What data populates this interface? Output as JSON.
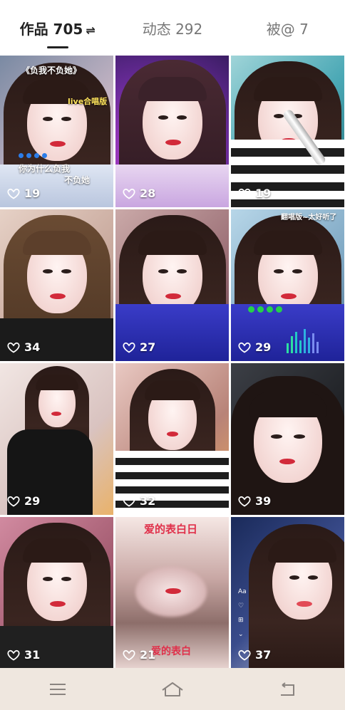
{
  "tabs": [
    {
      "label": "作品 705",
      "swap": "⇌"
    },
    {
      "label": "动态 292"
    },
    {
      "label": "被@ 7"
    }
  ],
  "videos": [
    {
      "likes": "19",
      "title": "《负我不负她》",
      "tag": "live合唱版",
      "sub1": "你为什么负我",
      "sub2": "不负她"
    },
    {
      "likes": "28"
    },
    {
      "likes": "19"
    },
    {
      "likes": "34"
    },
    {
      "likes": "27"
    },
    {
      "likes": "29",
      "caption": "翻唱版~太好听了"
    },
    {
      "likes": "29"
    },
    {
      "likes": "32"
    },
    {
      "likes": "39"
    },
    {
      "likes": "31"
    },
    {
      "likes": "21",
      "caption": "爱的表白日",
      "caption2": "爱的表白"
    },
    {
      "likes": "37"
    }
  ],
  "colors": {
    "accent": "#222222",
    "tab_inactive": "#777777",
    "navbar": "#efe7df"
  },
  "navbar": {
    "menu_icon": "menu-icon",
    "home_icon": "home-icon",
    "back_icon": "back-icon"
  }
}
